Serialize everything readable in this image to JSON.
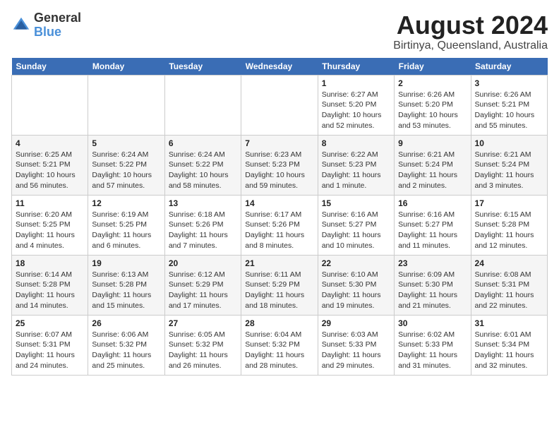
{
  "logo": {
    "general": "General",
    "blue": "Blue"
  },
  "header": {
    "title": "August 2024",
    "subtitle": "Birtinya, Queensland, Australia"
  },
  "days_of_week": [
    "Sunday",
    "Monday",
    "Tuesday",
    "Wednesday",
    "Thursday",
    "Friday",
    "Saturday"
  ],
  "weeks": [
    [
      {
        "day": "",
        "info": ""
      },
      {
        "day": "",
        "info": ""
      },
      {
        "day": "",
        "info": ""
      },
      {
        "day": "",
        "info": ""
      },
      {
        "day": "1",
        "info": "Sunrise: 6:27 AM\nSunset: 5:20 PM\nDaylight: 10 hours\nand 52 minutes."
      },
      {
        "day": "2",
        "info": "Sunrise: 6:26 AM\nSunset: 5:20 PM\nDaylight: 10 hours\nand 53 minutes."
      },
      {
        "day": "3",
        "info": "Sunrise: 6:26 AM\nSunset: 5:21 PM\nDaylight: 10 hours\nand 55 minutes."
      }
    ],
    [
      {
        "day": "4",
        "info": "Sunrise: 6:25 AM\nSunset: 5:21 PM\nDaylight: 10 hours\nand 56 minutes."
      },
      {
        "day": "5",
        "info": "Sunrise: 6:24 AM\nSunset: 5:22 PM\nDaylight: 10 hours\nand 57 minutes."
      },
      {
        "day": "6",
        "info": "Sunrise: 6:24 AM\nSunset: 5:22 PM\nDaylight: 10 hours\nand 58 minutes."
      },
      {
        "day": "7",
        "info": "Sunrise: 6:23 AM\nSunset: 5:23 PM\nDaylight: 10 hours\nand 59 minutes."
      },
      {
        "day": "8",
        "info": "Sunrise: 6:22 AM\nSunset: 5:23 PM\nDaylight: 11 hours\nand 1 minute."
      },
      {
        "day": "9",
        "info": "Sunrise: 6:21 AM\nSunset: 5:24 PM\nDaylight: 11 hours\nand 2 minutes."
      },
      {
        "day": "10",
        "info": "Sunrise: 6:21 AM\nSunset: 5:24 PM\nDaylight: 11 hours\nand 3 minutes."
      }
    ],
    [
      {
        "day": "11",
        "info": "Sunrise: 6:20 AM\nSunset: 5:25 PM\nDaylight: 11 hours\nand 4 minutes."
      },
      {
        "day": "12",
        "info": "Sunrise: 6:19 AM\nSunset: 5:25 PM\nDaylight: 11 hours\nand 6 minutes."
      },
      {
        "day": "13",
        "info": "Sunrise: 6:18 AM\nSunset: 5:26 PM\nDaylight: 11 hours\nand 7 minutes."
      },
      {
        "day": "14",
        "info": "Sunrise: 6:17 AM\nSunset: 5:26 PM\nDaylight: 11 hours\nand 8 minutes."
      },
      {
        "day": "15",
        "info": "Sunrise: 6:16 AM\nSunset: 5:27 PM\nDaylight: 11 hours\nand 10 minutes."
      },
      {
        "day": "16",
        "info": "Sunrise: 6:16 AM\nSunset: 5:27 PM\nDaylight: 11 hours\nand 11 minutes."
      },
      {
        "day": "17",
        "info": "Sunrise: 6:15 AM\nSunset: 5:28 PM\nDaylight: 11 hours\nand 12 minutes."
      }
    ],
    [
      {
        "day": "18",
        "info": "Sunrise: 6:14 AM\nSunset: 5:28 PM\nDaylight: 11 hours\nand 14 minutes."
      },
      {
        "day": "19",
        "info": "Sunrise: 6:13 AM\nSunset: 5:28 PM\nDaylight: 11 hours\nand 15 minutes."
      },
      {
        "day": "20",
        "info": "Sunrise: 6:12 AM\nSunset: 5:29 PM\nDaylight: 11 hours\nand 17 minutes."
      },
      {
        "day": "21",
        "info": "Sunrise: 6:11 AM\nSunset: 5:29 PM\nDaylight: 11 hours\nand 18 minutes."
      },
      {
        "day": "22",
        "info": "Sunrise: 6:10 AM\nSunset: 5:30 PM\nDaylight: 11 hours\nand 19 minutes."
      },
      {
        "day": "23",
        "info": "Sunrise: 6:09 AM\nSunset: 5:30 PM\nDaylight: 11 hours\nand 21 minutes."
      },
      {
        "day": "24",
        "info": "Sunrise: 6:08 AM\nSunset: 5:31 PM\nDaylight: 11 hours\nand 22 minutes."
      }
    ],
    [
      {
        "day": "25",
        "info": "Sunrise: 6:07 AM\nSunset: 5:31 PM\nDaylight: 11 hours\nand 24 minutes."
      },
      {
        "day": "26",
        "info": "Sunrise: 6:06 AM\nSunset: 5:32 PM\nDaylight: 11 hours\nand 25 minutes."
      },
      {
        "day": "27",
        "info": "Sunrise: 6:05 AM\nSunset: 5:32 PM\nDaylight: 11 hours\nand 26 minutes."
      },
      {
        "day": "28",
        "info": "Sunrise: 6:04 AM\nSunset: 5:32 PM\nDaylight: 11 hours\nand 28 minutes."
      },
      {
        "day": "29",
        "info": "Sunrise: 6:03 AM\nSunset: 5:33 PM\nDaylight: 11 hours\nand 29 minutes."
      },
      {
        "day": "30",
        "info": "Sunrise: 6:02 AM\nSunset: 5:33 PM\nDaylight: 11 hours\nand 31 minutes."
      },
      {
        "day": "31",
        "info": "Sunrise: 6:01 AM\nSunset: 5:34 PM\nDaylight: 11 hours\nand 32 minutes."
      }
    ]
  ]
}
